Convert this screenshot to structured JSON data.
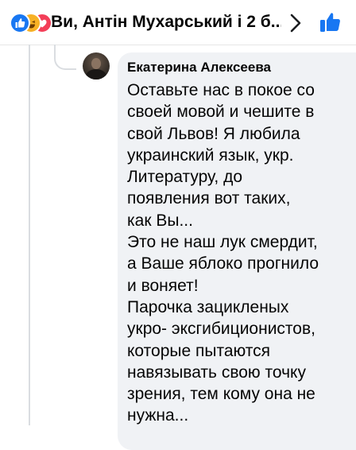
{
  "header": {
    "title": "Ви, Антін Мухарський і 2 б...",
    "reactions": [
      "like-reaction",
      "haha-reaction",
      "love-reaction"
    ],
    "chevron_icon": "chevron-right-icon",
    "like_button_icon": "thumbs-up-icon"
  },
  "comment": {
    "author": "Екатерина Алексеева",
    "lines": [
      "Оставьте нас в покое со",
      "своей мовой и чешите в",
      "свой Львов! Я любила",
      "украинский язык, укр.",
      "Литературу, до",
      "появления вот таких,",
      "как Вы...",
      "Это не наш лук смердит,",
      "а Ваше яблоко прогнило",
      "и воняет!",
      "Парочка зацикленых",
      "укро- эксгибиционистов,",
      "которые пытаются",
      "навязывать свою точку",
      "зрения, тем кому она не",
      "нужна..."
    ]
  },
  "colors": {
    "accent": "#1877f2",
    "bubble": "#f0f2f5",
    "text": "#050505",
    "love": "#f33e58",
    "haha": "#f7b125"
  }
}
